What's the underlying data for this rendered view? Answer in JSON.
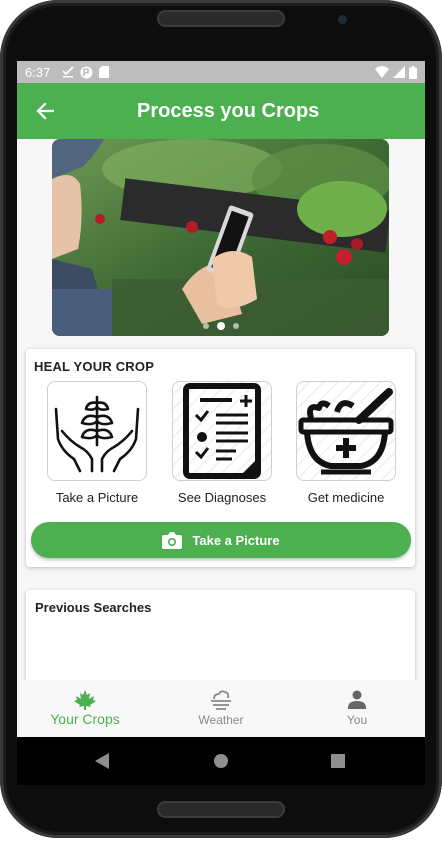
{
  "status_bar": {
    "time": "6:37",
    "icons": [
      "download-done-icon",
      "app-icon",
      "sd-card-icon",
      "wifi-icon",
      "signal-icon",
      "battery-icon"
    ]
  },
  "app_bar": {
    "title": "Process you Crops",
    "back_icon": "arrow-back-icon",
    "color": "#4caf50"
  },
  "carousel": {
    "image": "woman holding phone photographing strawberry plants",
    "pages": 3,
    "active_index": 1
  },
  "heal_card": {
    "title": "HEAL YOUR CROP",
    "options": [
      {
        "label": "Take a Picture",
        "icon": "hands-plant-icon"
      },
      {
        "label": "See Diagnoses",
        "icon": "clipboard-checklist-icon"
      },
      {
        "label": "Get medicine",
        "icon": "mortar-medicine-icon"
      }
    ],
    "button": {
      "label": "Take a Picture",
      "icon": "camera-icon"
    }
  },
  "previous_searches": {
    "title": "Previous Searches"
  },
  "bottom_nav": {
    "items": [
      {
        "label": "Your Crops",
        "icon": "maple-leaf-icon",
        "active": true
      },
      {
        "label": "Weather",
        "icon": "cloud-fog-icon",
        "active": false
      },
      {
        "label": "You",
        "icon": "person-icon",
        "active": false
      }
    ],
    "active_color": "#4caf50",
    "inactive_color": "#8a8a8a"
  },
  "system_nav": [
    "back-triangle-icon",
    "home-circle-icon",
    "recents-square-icon"
  ]
}
